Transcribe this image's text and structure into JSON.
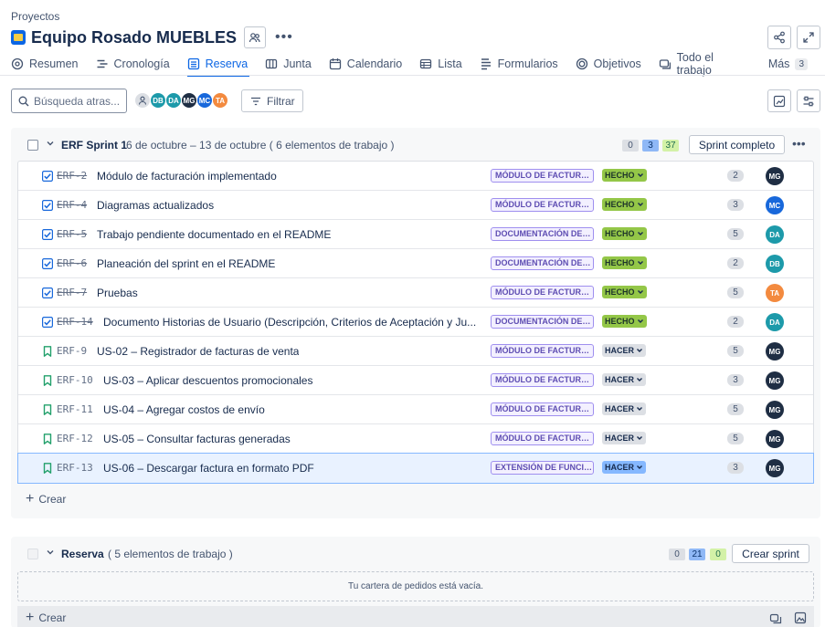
{
  "breadcrumb": "Proyectos",
  "project": {
    "title": "Equipo Rosado MUEBLES"
  },
  "tabs": [
    {
      "label": "Resumen",
      "icon": "globe-icon"
    },
    {
      "label": "Cronología",
      "icon": "timeline-icon"
    },
    {
      "label": "Reserva",
      "icon": "backlog-icon",
      "active": true
    },
    {
      "label": "Junta",
      "icon": "board-icon"
    },
    {
      "label": "Calendario",
      "icon": "calendar-icon"
    },
    {
      "label": "Lista",
      "icon": "list-icon"
    },
    {
      "label": "Formularios",
      "icon": "forms-icon"
    },
    {
      "label": "Objetivos",
      "icon": "goals-icon"
    },
    {
      "label": "Todo el trabajo",
      "icon": "all-work-icon"
    },
    {
      "label": "Más",
      "count": "3"
    }
  ],
  "toolbar": {
    "search_placeholder": "Búsqueda atras...",
    "filter_label": "Filtrar",
    "avatars": [
      {
        "initials": "",
        "color": "#dcdfe4"
      },
      {
        "initials": "DB",
        "color": "#1d9aaa"
      },
      {
        "initials": "DA",
        "color": "#1d9aaa"
      },
      {
        "initials": "MG",
        "color": "#1f2e44"
      },
      {
        "initials": "MC",
        "color": "#1868db"
      },
      {
        "initials": "TA",
        "color": "#f38a3f"
      }
    ]
  },
  "sprint": {
    "name": "ERF Sprint 1",
    "dates": "6 de octubre – 13 de octubre ( 6 elementos de trabajo )",
    "counts": {
      "todo": "0",
      "in_progress": "3",
      "done": "37"
    },
    "complete_label": "Sprint completo",
    "create_label": "Crear",
    "items": [
      {
        "key": "ERF-2",
        "summary": "Módulo de facturación implementado",
        "epic": "MÓDULO DE FACTURACIÓN",
        "status": "HECHO",
        "done": true,
        "points": "2",
        "assignee": "MG",
        "assignee_color": "#1f2e44"
      },
      {
        "key": "ERF-4",
        "summary": "Diagramas actualizados",
        "epic": "MÓDULO DE FACTURACIÓN",
        "status": "HECHO",
        "done": true,
        "points": "3",
        "assignee": "MC",
        "assignee_color": "#1868db"
      },
      {
        "key": "ERF-5",
        "summary": "Trabajo pendiente documentado en el README",
        "epic": "DOCUMENTACIÓN DEL PROYECTO",
        "status": "HECHO",
        "done": true,
        "points": "5",
        "assignee": "DA",
        "assignee_color": "#1d9aaa"
      },
      {
        "key": "ERF-6",
        "summary": "Planeación del sprint en el README",
        "epic": "DOCUMENTACIÓN DEL PROYECTO",
        "status": "HECHO",
        "done": true,
        "points": "2",
        "assignee": "DB",
        "assignee_color": "#1d9aaa"
      },
      {
        "key": "ERF-7",
        "summary": "Pruebas",
        "epic": "MÓDULO DE FACTURACIÓN",
        "status": "HECHO",
        "done": true,
        "points": "5",
        "assignee": "TA",
        "assignee_color": "#f38a3f"
      },
      {
        "key": "ERF-14",
        "summary": "Documento Historias de Usuario (Descripción, Criterios de Aceptación y Ju...",
        "epic": "DOCUMENTACIÓN DEL PROYECTO",
        "status": "HECHO",
        "done": true,
        "points": "2",
        "assignee": "DA",
        "assignee_color": "#1d9aaa"
      },
      {
        "key": "ERF-9",
        "summary": "US-02 – Registrador de facturas de venta",
        "epic": "MÓDULO DE FACTURACIÓN",
        "status": "HACER",
        "done": false,
        "points": "5",
        "assignee": "MG",
        "assignee_color": "#1f2e44"
      },
      {
        "key": "ERF-10",
        "summary": "US-03 – Aplicar descuentos promocionales",
        "epic": "MÓDULO DE FACTURACIÓN",
        "status": "HACER",
        "done": false,
        "points": "3",
        "assignee": "MG",
        "assignee_color": "#1f2e44"
      },
      {
        "key": "ERF-11",
        "summary": "US-04 – Agregar costos de envío",
        "epic": "MÓDULO DE FACTURACIÓN",
        "status": "HACER",
        "done": false,
        "points": "5",
        "assignee": "MG",
        "assignee_color": "#1f2e44"
      },
      {
        "key": "ERF-12",
        "summary": "US-05 – Consultar facturas generadas",
        "epic": "MÓDULO DE FACTURACIÓN",
        "status": "HACER",
        "done": false,
        "points": "5",
        "assignee": "MG",
        "assignee_color": "#1f2e44"
      },
      {
        "key": "ERF-13",
        "summary": "US-06 – Descargar factura en formato PDF",
        "epic": "EXTENSIÓN DE FUNCIONALIDADES",
        "status": "HACER",
        "done": false,
        "points": "3",
        "assignee": "MG",
        "assignee_color": "#1f2e44",
        "selected": true
      }
    ]
  },
  "backlog": {
    "name": "Reserva",
    "count_text": "( 5 elementos de trabajo )",
    "counts": {
      "todo": "0",
      "in_progress": "21",
      "done": "0"
    },
    "create_sprint_label": "Crear sprint",
    "empty_text": "Tu cartera de pedidos está vacía.",
    "create_label": "Crear"
  }
}
